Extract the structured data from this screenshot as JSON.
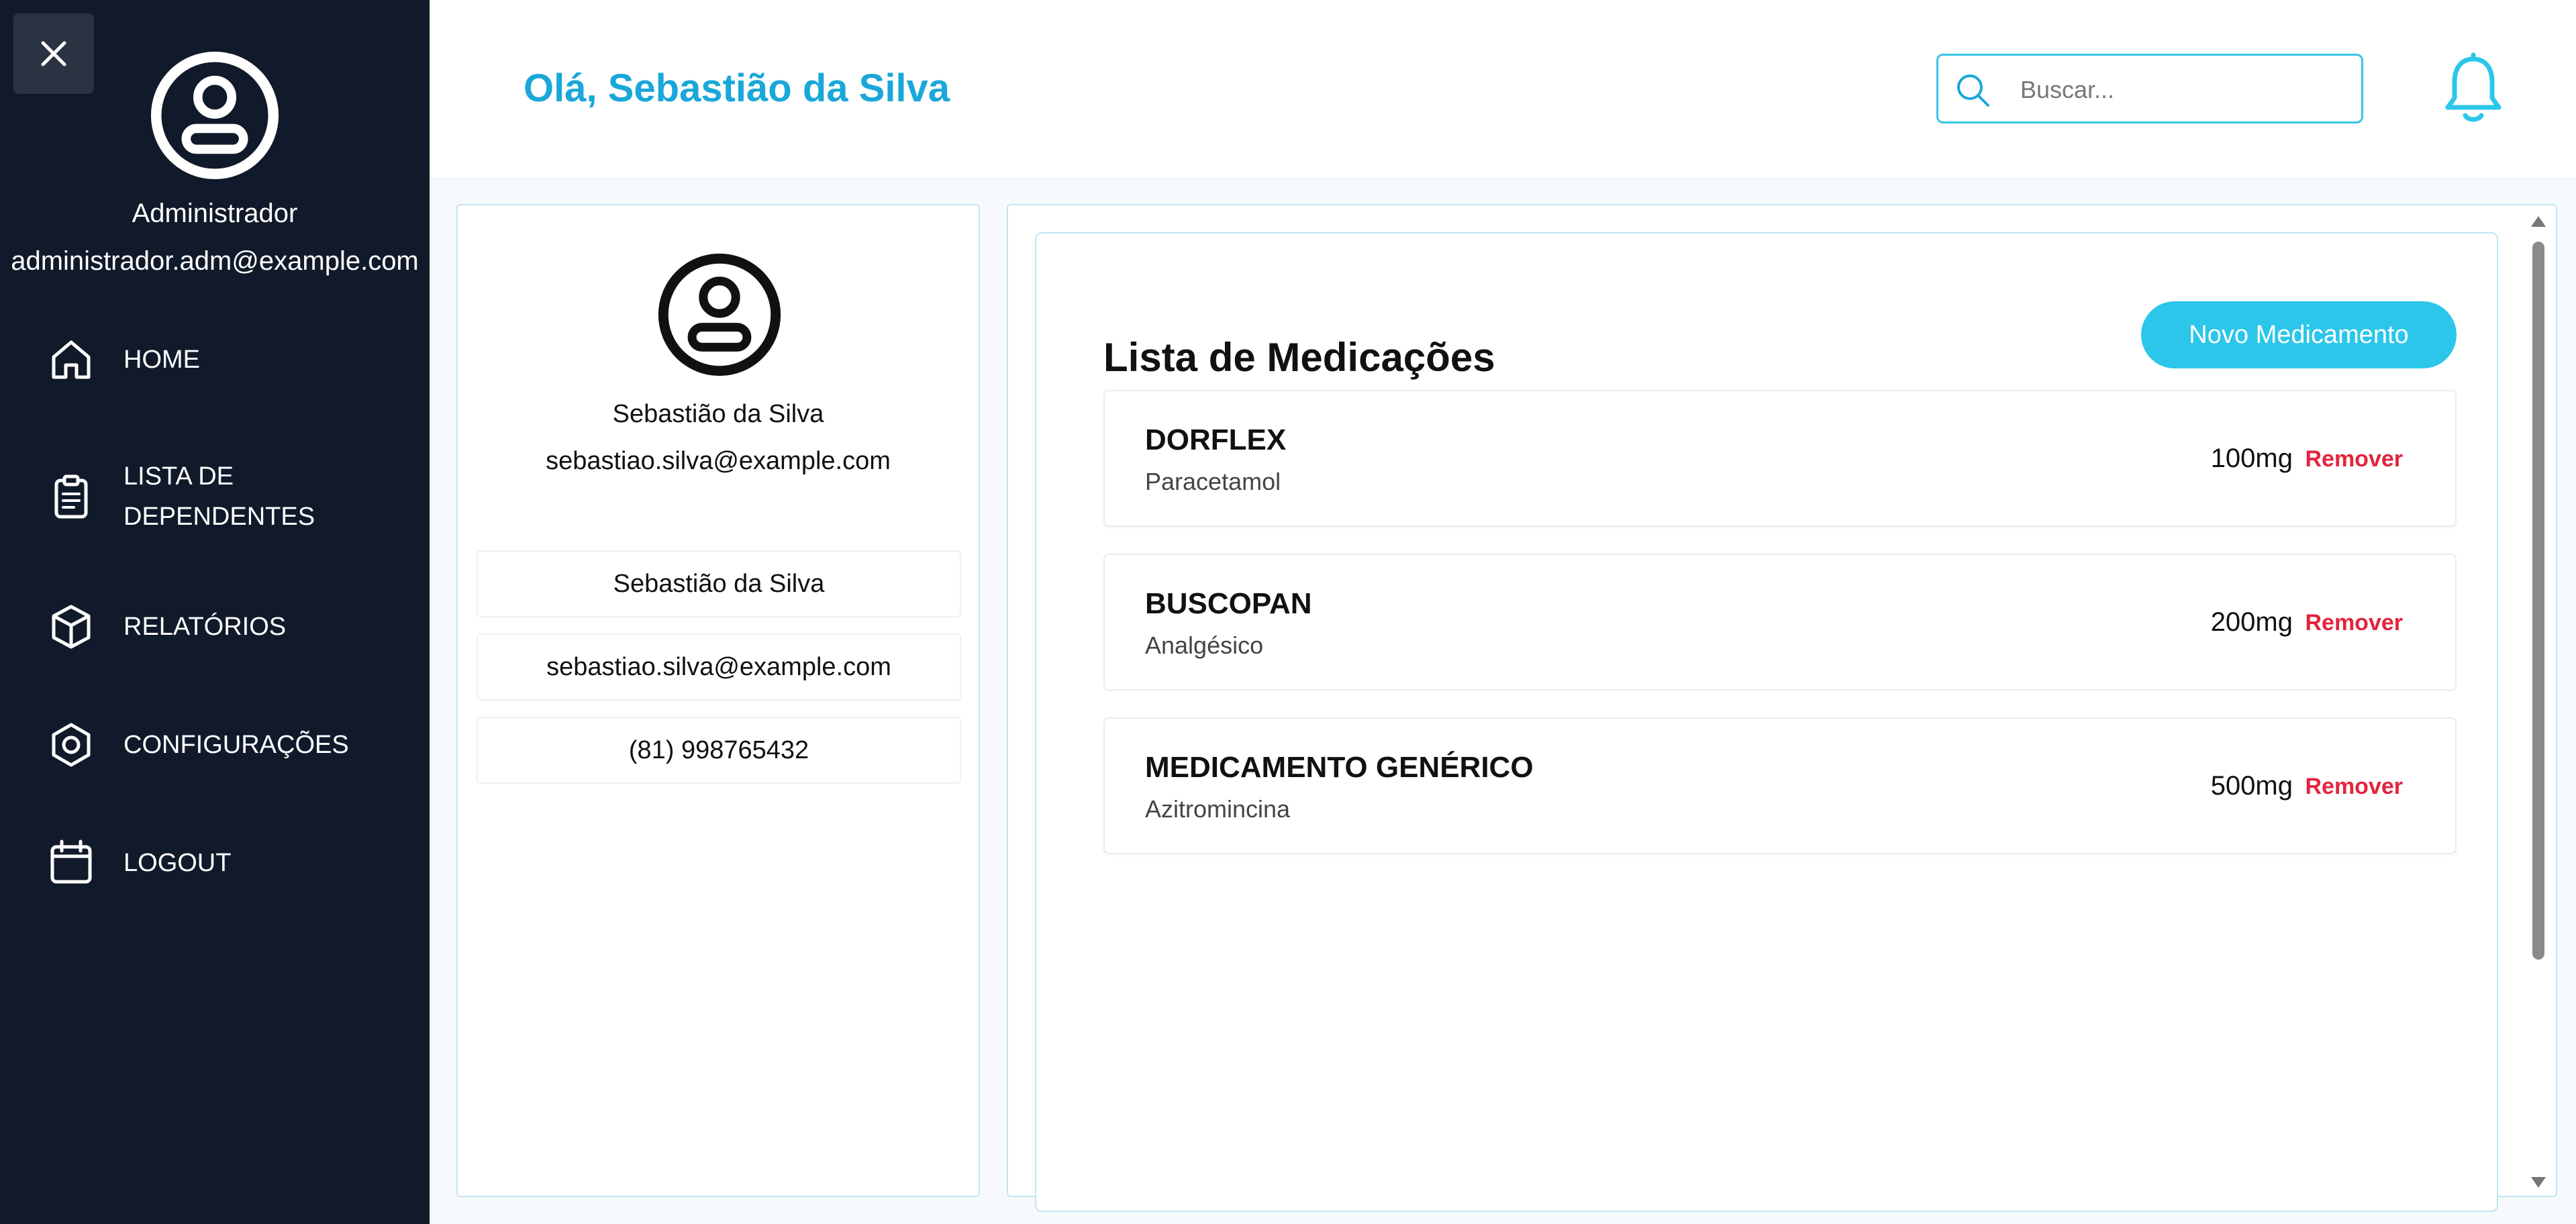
{
  "sidebar": {
    "role": "Administrador",
    "email": "administrador.adm@example.com",
    "items": [
      {
        "label": "HOME",
        "icon": "home-icon"
      },
      {
        "label": "LISTA DE DEPENDENTES",
        "icon": "clipboard-icon"
      },
      {
        "label": "RELATÓRIOS",
        "icon": "cube-icon"
      },
      {
        "label": "CONFIGURAÇÕES",
        "icon": "hexagon-settings-icon"
      },
      {
        "label": "LOGOUT",
        "icon": "calendar-icon"
      }
    ]
  },
  "header": {
    "greeting": "Olá, Sebastião da Silva",
    "search_placeholder": "Buscar...",
    "accent_color": "#1aa7d9"
  },
  "profile": {
    "name": "Sebastião da Silva",
    "email": "sebastiao.silva@example.com",
    "fields": [
      "Sebastião da Silva",
      "sebastiao.silva@example.com",
      "(81) 998765432"
    ]
  },
  "medications": {
    "title": "Lista de Medicações",
    "new_button": "Novo Medicamento",
    "remove_label": "Remover",
    "items": [
      {
        "name": "DORFLEX",
        "generic": "Paracetamol",
        "dose": "100mg"
      },
      {
        "name": "BUSCOPAN",
        "generic": "Analgésico",
        "dose": "200mg"
      },
      {
        "name": "MEDICAMENTO GENÉRICO",
        "generic": "Azitromincina",
        "dose": "500mg"
      }
    ]
  }
}
